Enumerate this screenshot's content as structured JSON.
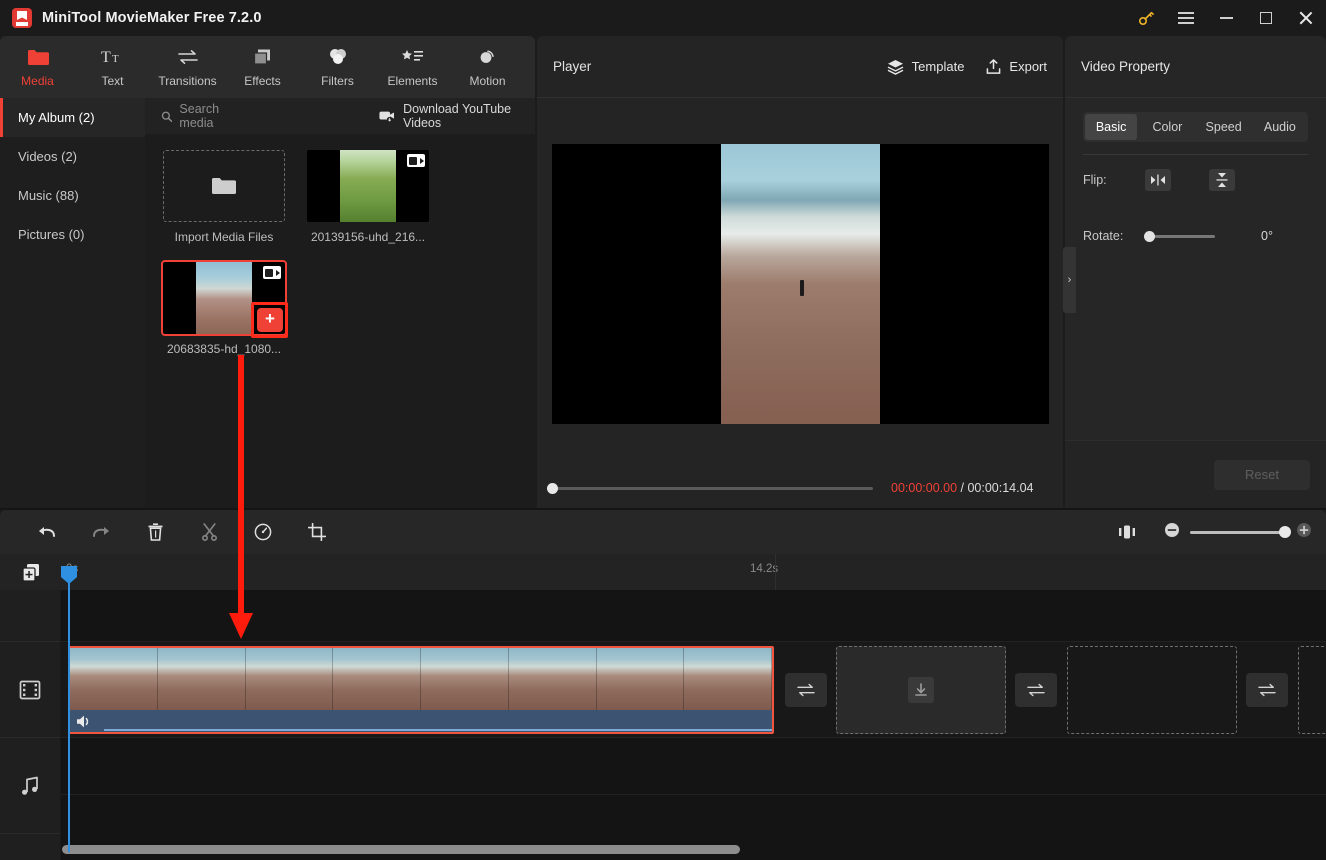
{
  "window": {
    "title": "MiniTool MovieMaker Free 7.2.0",
    "controls": {
      "key": "key-icon",
      "menu": "menu-icon",
      "minimize": "–",
      "maximize": "□",
      "close": "✕"
    }
  },
  "ribbon": {
    "tabs": [
      {
        "label": "Media",
        "icon": "folder-icon",
        "active": true
      },
      {
        "label": "Text",
        "icon": "text-icon",
        "active": false
      },
      {
        "label": "Transitions",
        "icon": "transitions-icon",
        "active": false
      },
      {
        "label": "Effects",
        "icon": "effects-icon",
        "active": false
      },
      {
        "label": "Filters",
        "icon": "filters-icon",
        "active": false
      },
      {
        "label": "Elements",
        "icon": "elements-icon",
        "active": false
      },
      {
        "label": "Motion",
        "icon": "motion-icon",
        "active": false
      }
    ]
  },
  "library": {
    "categories": [
      {
        "label": "My Album (2)",
        "active": true
      },
      {
        "label": "Videos (2)",
        "active": false
      },
      {
        "label": "Music (88)",
        "active": false
      },
      {
        "label": "Pictures (0)",
        "active": false
      }
    ],
    "search_placeholder": "Search media",
    "download_youtube": "Download YouTube Videos",
    "import_label": "Import Media Files",
    "items": [
      {
        "name": "20139156-uhd_216...",
        "type": "video",
        "selected": false
      },
      {
        "name": "20683835-hd_1080...",
        "type": "video",
        "selected": true,
        "add_button": "+"
      }
    ]
  },
  "player": {
    "title": "Player",
    "template_label": "Template",
    "export_label": "Export",
    "current_time": "00:00:00.00",
    "separator": " / ",
    "total_time": "00:00:14.04",
    "aspect_ratio": "16:9",
    "buttons": {
      "play": "play-icon",
      "prev_frame": "previous-frame-icon",
      "next_frame": "next-frame-icon",
      "stop": "stop-icon",
      "volume": "volume-icon",
      "fullscreen": "fullscreen-icon"
    }
  },
  "property": {
    "title": "Video Property",
    "tabs": [
      {
        "label": "Basic",
        "active": true
      },
      {
        "label": "Color",
        "active": false
      },
      {
        "label": "Speed",
        "active": false
      },
      {
        "label": "Audio",
        "active": false
      }
    ],
    "flip_label": "Flip:",
    "flip_horizontal": "flip-horizontal-icon",
    "flip_vertical": "flip-vertical-icon",
    "rotate_label": "Rotate:",
    "rotate_value": "0°",
    "reset_label": "Reset",
    "collapse": "›"
  },
  "timeline": {
    "toolbar": [
      {
        "name": "undo",
        "icon": "undo-icon",
        "enabled": true
      },
      {
        "name": "redo",
        "icon": "redo-icon",
        "enabled": false
      },
      {
        "name": "delete",
        "icon": "trash-icon",
        "enabled": true
      },
      {
        "name": "split",
        "icon": "scissors-icon",
        "enabled": false
      },
      {
        "name": "speed",
        "icon": "speed-icon",
        "enabled": true
      },
      {
        "name": "crop",
        "icon": "crop-icon",
        "enabled": true
      }
    ],
    "zoom": {
      "fit": "fit-timeline-icon",
      "zoom_out": "−",
      "zoom_in": "+"
    },
    "add_track": "add-track-icon",
    "ruler": {
      "start_label": "0s",
      "end_label": "14.2s"
    },
    "tracks": [
      {
        "name": "text-track",
        "icon": ""
      },
      {
        "name": "video-track",
        "icon": "film-icon"
      },
      {
        "name": "audio-track",
        "icon": "music-note-icon"
      }
    ],
    "clips": [
      {
        "name": "beach-clip",
        "selected": true,
        "frames": 8,
        "audio_icon": "volume-icon"
      }
    ],
    "transitions": [
      {
        "name": "transition-slot-1",
        "icon": "transition-icon"
      },
      {
        "name": "transition-slot-2",
        "icon": "transition-icon"
      },
      {
        "name": "transition-slot-3",
        "icon": "transition-icon"
      }
    ],
    "drop_slots": [
      {
        "name": "drop-slot-1",
        "icon": "download-icon"
      },
      {
        "name": "drop-slot-2",
        "icon": ""
      },
      {
        "name": "drop-slot-3",
        "icon": ""
      }
    ]
  },
  "annotation": {
    "highlight_color": "#ff1c0d",
    "arrow": "drag-media-to-timeline-arrow"
  },
  "colors": {
    "accent": "#ef4136",
    "annotation": "#ff1c0d",
    "playhead": "#2f8fe0",
    "audio_band": "#3d5372"
  }
}
